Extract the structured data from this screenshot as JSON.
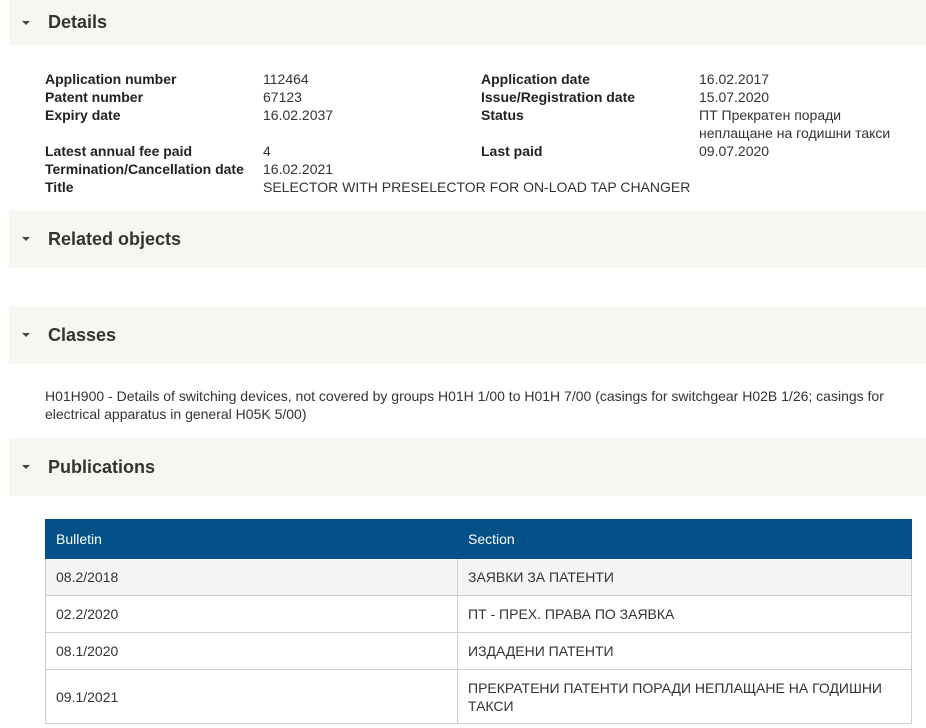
{
  "sections": {
    "details": "Details",
    "related": "Related objects",
    "classes": "Classes",
    "publications": "Publications"
  },
  "details": {
    "rows": [
      {
        "l1": "Application number",
        "v1": "112464",
        "l2": "Application date",
        "v2": "16.02.2017"
      },
      {
        "l1": "Patent number",
        "v1": "67123",
        "l2": "Issue/Registration date",
        "v2": "15.07.2020"
      },
      {
        "l1": "Expiry date",
        "v1": "16.02.2037",
        "l2": "Status",
        "v2": "ПТ Прекратен поради неплащане на годишни такси"
      },
      {
        "l1": "Latest annual fee paid",
        "v1": "4",
        "l2": "Last paid",
        "v2": "09.07.2020"
      },
      {
        "l1": "Termination/Cancellation date",
        "v1": "16.02.2021",
        "l2": "",
        "v2": ""
      }
    ],
    "title_label": "Title",
    "title_value": "SELECTOR WITH PRESELECTOR FOR ON-LOAD TAP CHANGER"
  },
  "classes": {
    "text": "H01H900 - Details of switching devices, not covered by groups H01H 1/00 to H01H 7/00 (casings for switchgear H02B 1/26; casings for electrical apparatus in general H05K 5/00)"
  },
  "publications": {
    "headers": [
      "Bulletin",
      "Section"
    ],
    "rows": [
      [
        "08.2/2018",
        "ЗАЯВКИ ЗА ПАТЕНТИ"
      ],
      [
        "02.2/2020",
        "ПТ - ПРЕХ. ПРАВА ПО ЗАЯВКА"
      ],
      [
        "08.1/2020",
        "ИЗДАДЕНИ ПАТЕНТИ"
      ],
      [
        "09.1/2021",
        "ПРЕКРАТЕНИ ПАТЕНТИ ПОРАДИ НЕПЛАЩАНЕ НА ГОДИШНИ ТАКСИ"
      ]
    ]
  },
  "colors": {
    "section_bg": "#f7f6f1",
    "table_header_bg": "#045088"
  },
  "icons": {
    "section_toggle": "caret-down-icon"
  }
}
